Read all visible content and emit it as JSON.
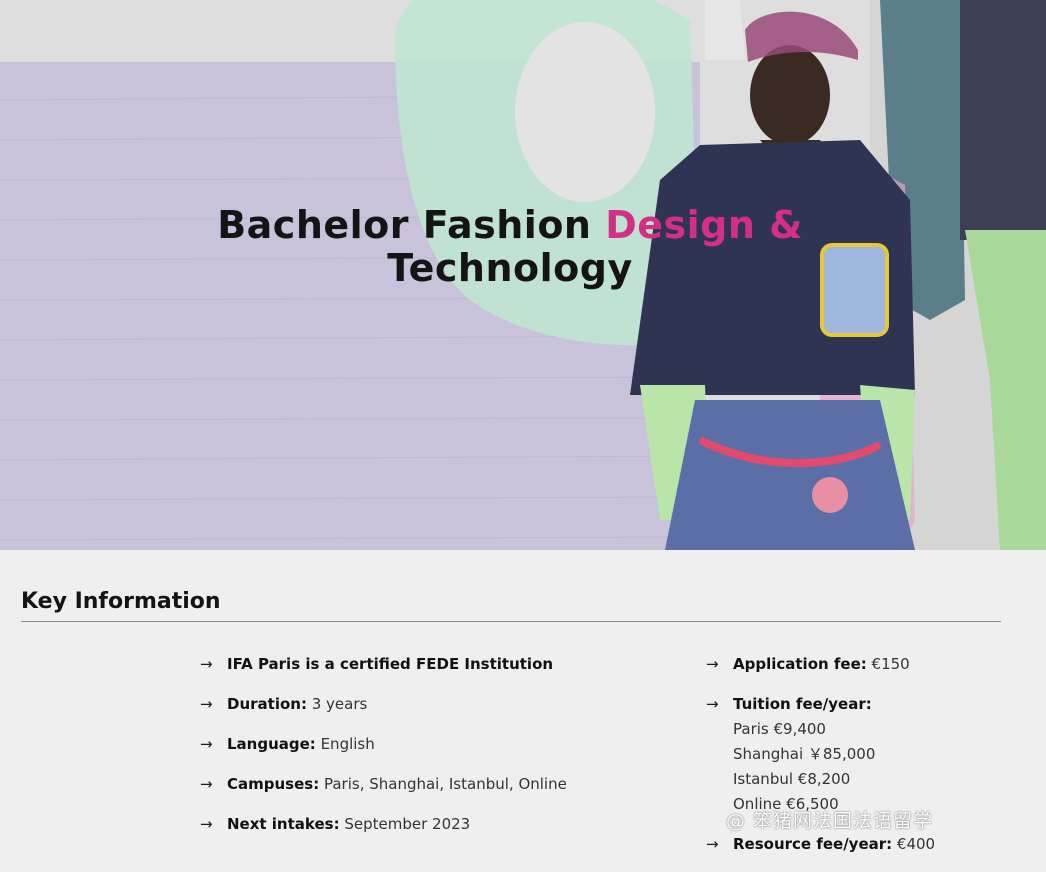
{
  "hero": {
    "title_line1": "Bachelor Fashion ",
    "title_accent": "Design &",
    "title_line2": "Technology"
  },
  "key_info": {
    "heading": "Key Information",
    "left": [
      {
        "label": "IFA Paris is a certified FEDE Institution",
        "value": ""
      },
      {
        "label": "Duration:",
        "value": " 3 years"
      },
      {
        "label": "Language:",
        "value": " English"
      },
      {
        "label": "Campuses:",
        "value": " Paris, Shanghai, Istanbul, Online"
      },
      {
        "label": "Next intakes:",
        "value": " September 2023"
      }
    ],
    "application_fee": {
      "label": "Application fee:",
      "value": " €150"
    },
    "tuition": {
      "label": "Tuition fee/year:",
      "lines": [
        "Paris €9,400",
        "Shanghai ￥85,000",
        "Istanbul €8,200",
        "Online €6,500"
      ]
    },
    "resource_fee": {
      "label": "Resource fee/year:",
      "value": " €400"
    }
  },
  "arrow_glyph": "→",
  "colors": {
    "accent": "#d42f86",
    "lavender": "#c9c3db",
    "mint": "#b9e2cc"
  },
  "watermark": "@ 笨猪网法国法语留学"
}
